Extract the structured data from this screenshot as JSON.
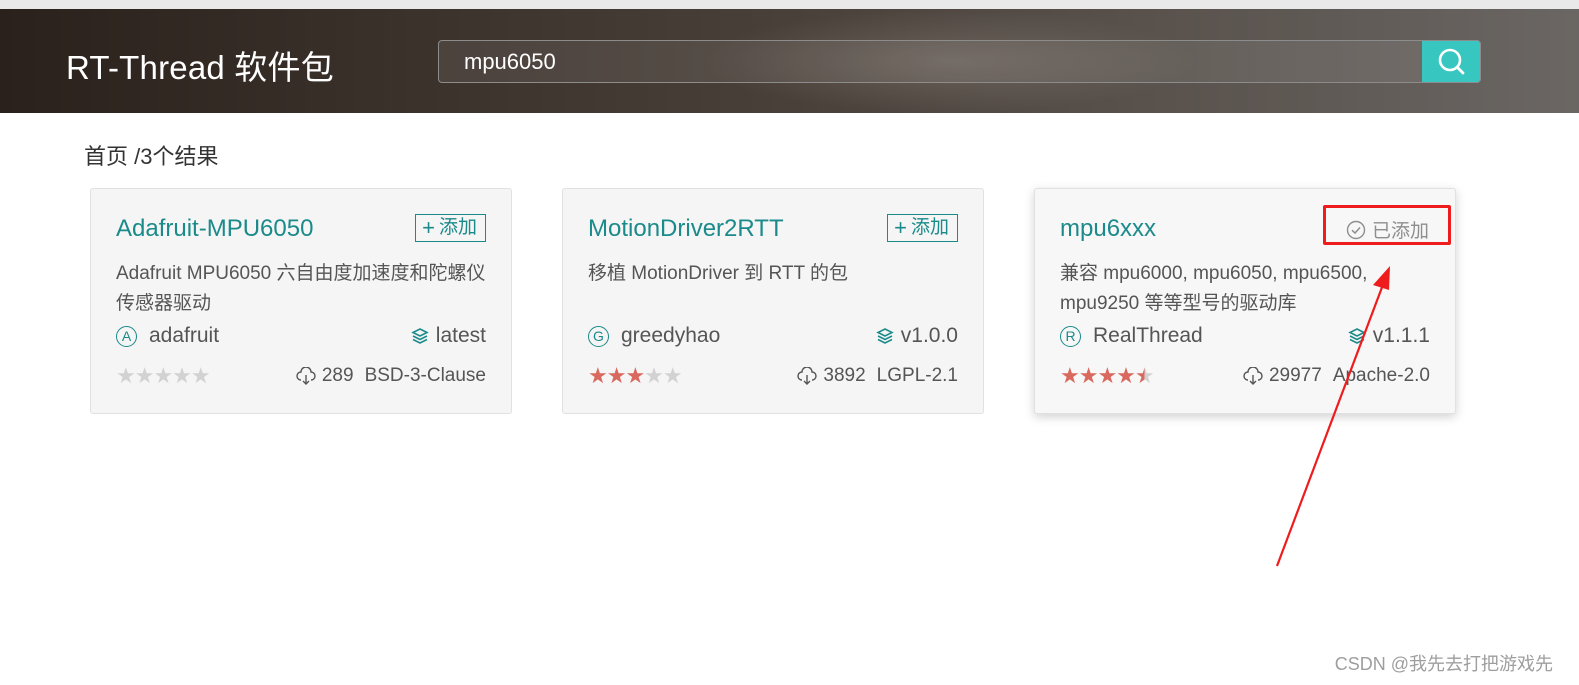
{
  "header": {
    "title": "RT-Thread 软件包"
  },
  "search": {
    "value": "mpu6050",
    "button_icon": "search-icon"
  },
  "breadcrumb": "首页 /3个结果",
  "packages": [
    {
      "name": "Adafruit-MPU6050",
      "action": "添加",
      "action_state": "add",
      "description": "Adafruit MPU6050 六自由度加速度和陀螺仪传感器驱动",
      "author_initial": "A",
      "author": "adafruit",
      "version": "latest",
      "rating": 0,
      "downloads": "289",
      "license": "BSD-3-Clause"
    },
    {
      "name": "MotionDriver2RTT",
      "action": "添加",
      "action_state": "add",
      "description": "移植 MotionDriver 到 RTT 的包",
      "author_initial": "G",
      "author": "greedyhao",
      "version": "v1.0.0",
      "rating": 3,
      "downloads": "3892",
      "license": "LGPL-2.1"
    },
    {
      "name": "mpu6xxx",
      "action": "已添加",
      "action_state": "added",
      "description": "兼容 mpu6000, mpu6050, mpu6500, mpu9250 等等型号的驱动库",
      "author_initial": "R",
      "author": "RealThread",
      "version": "v1.1.1",
      "rating": 4.5,
      "downloads": "29977",
      "license": "Apache-2.0"
    }
  ],
  "watermark": "CSDN @我先去打把游戏先",
  "colors": {
    "accent": "#1b8a8a",
    "search_button": "#38c6c1",
    "star_on": "#d9695f",
    "star_off": "#d2d2d2",
    "annotation": "#ee1c1c"
  }
}
